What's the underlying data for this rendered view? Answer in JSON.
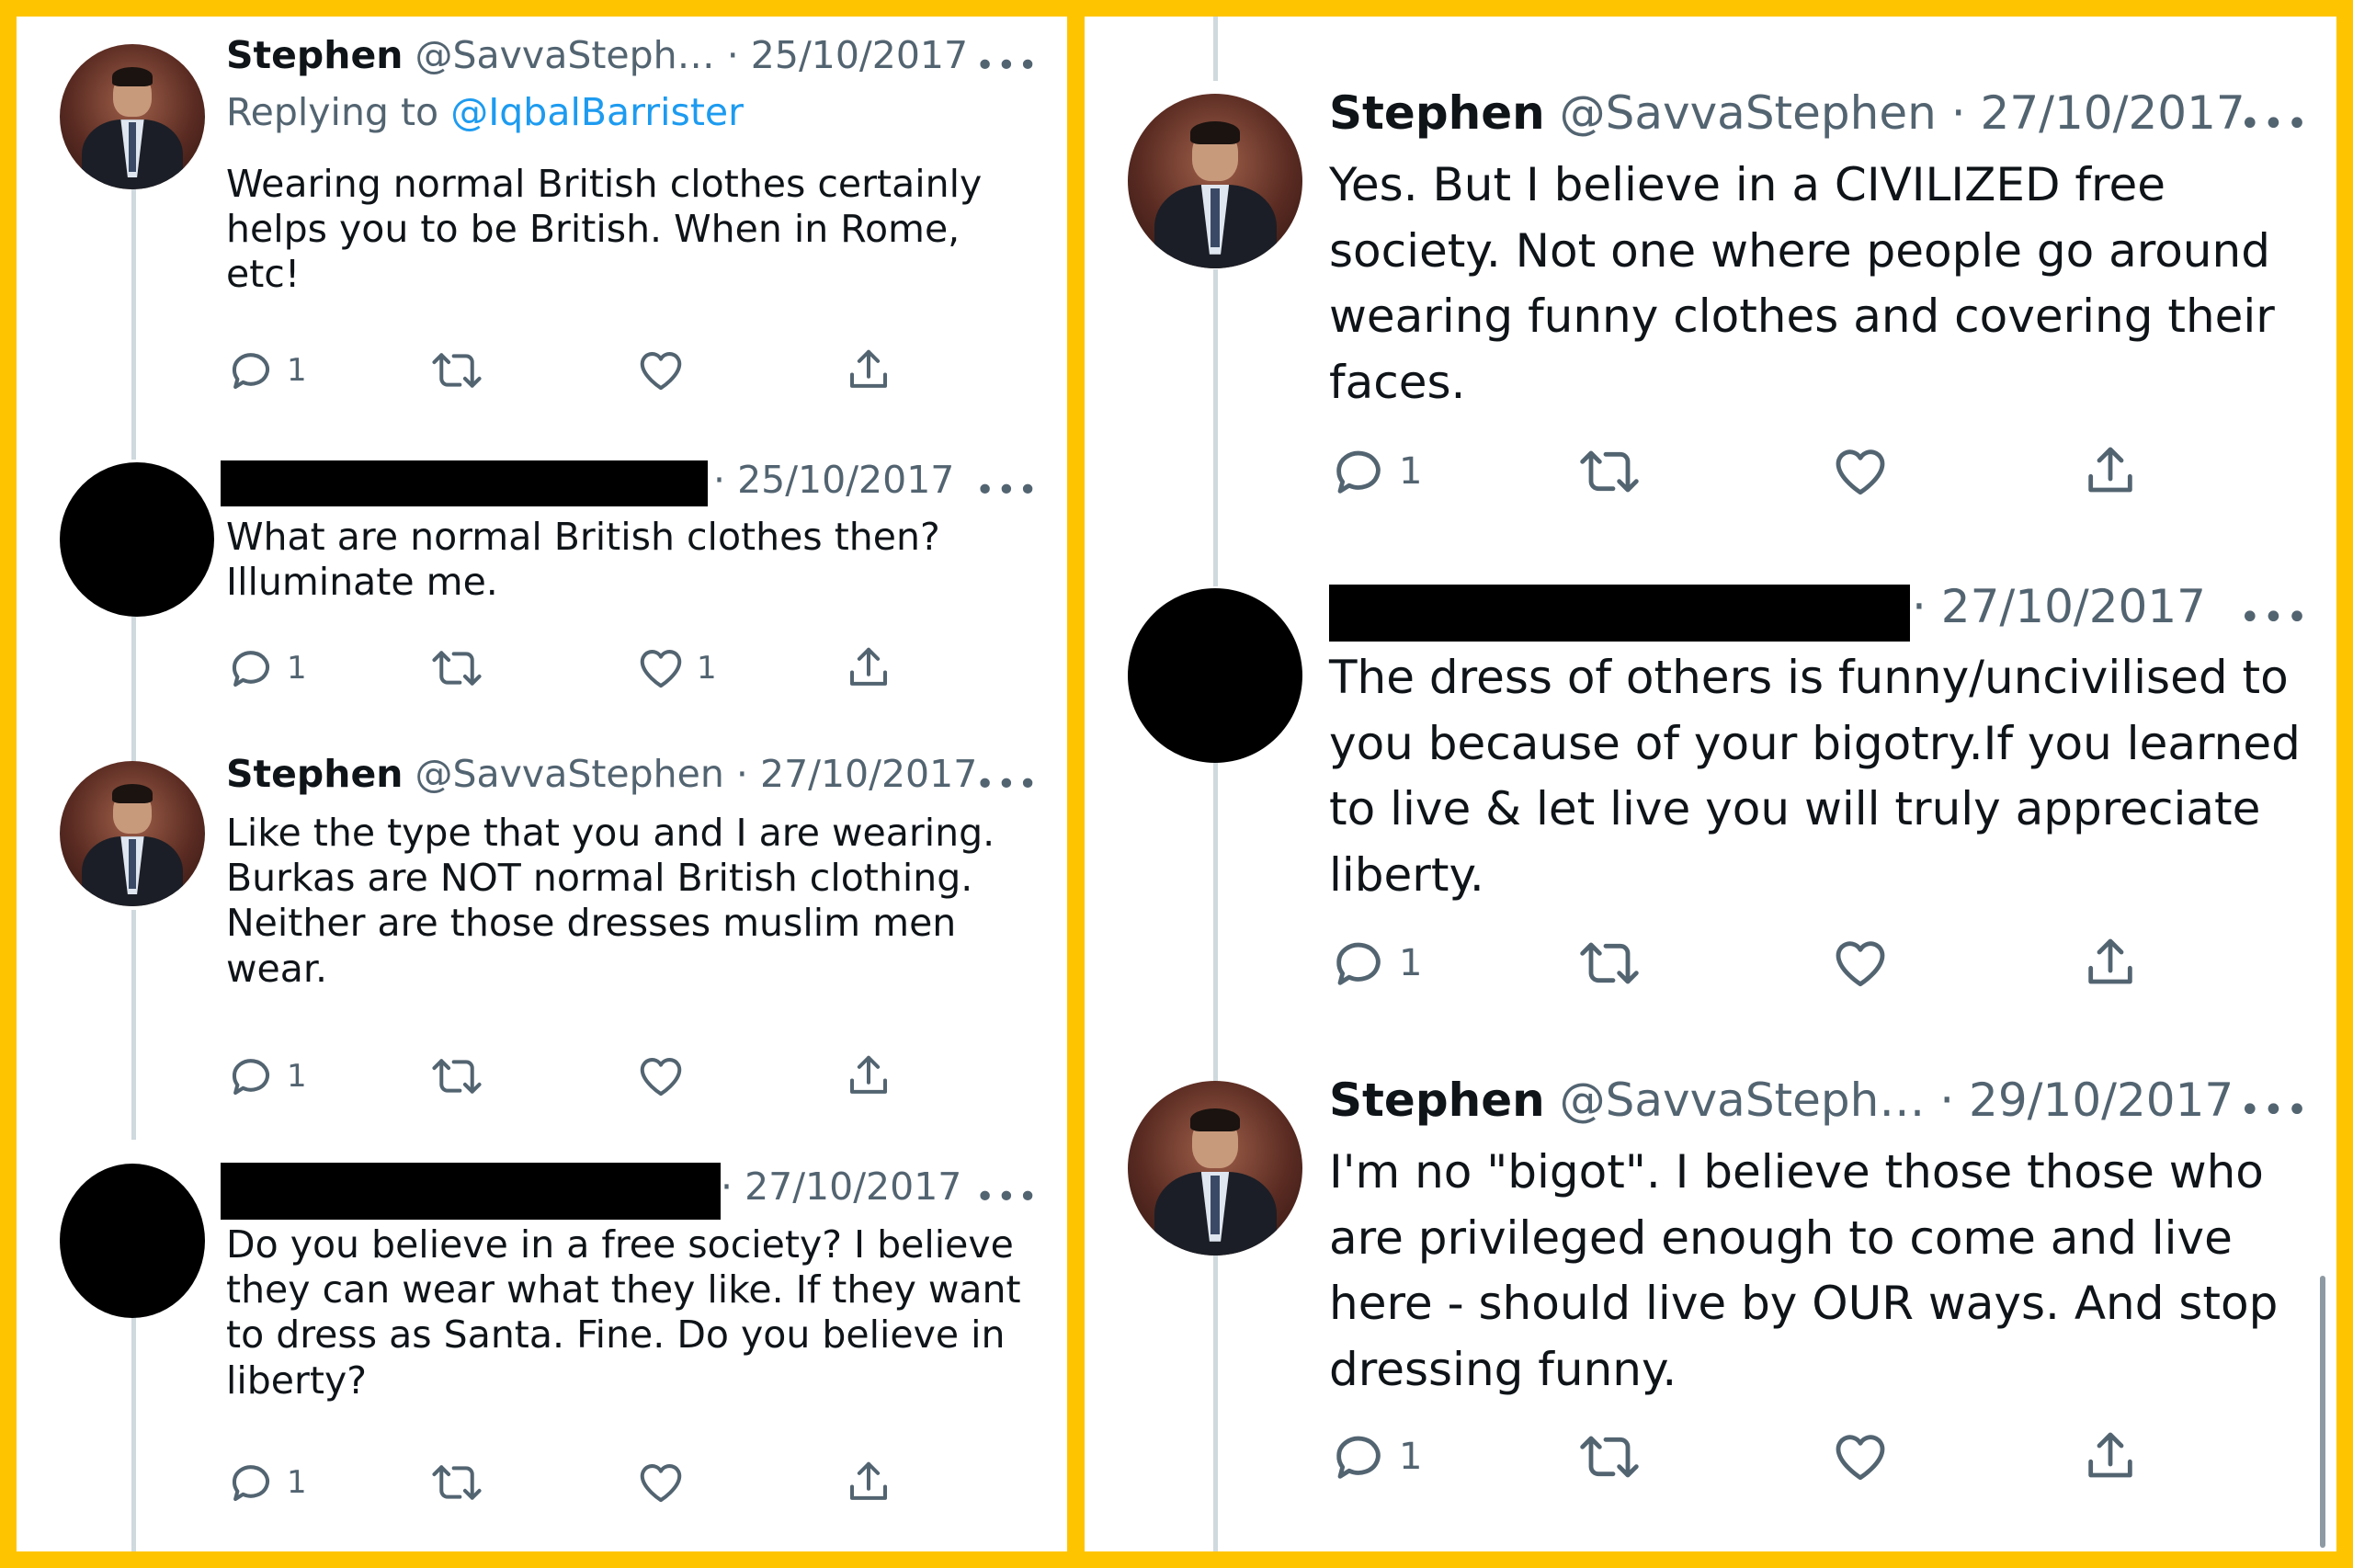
{
  "colors": {
    "frame": "#FFC400",
    "text": "#0f1419",
    "muted": "#536471",
    "link": "#1d9bf0",
    "thread_line": "#cfd9de"
  },
  "icons": {
    "reply": "speech-bubble-icon",
    "retweet": "retweet-icon",
    "like": "heart-icon",
    "share": "share-icon",
    "more": "more-dots-icon"
  },
  "left": {
    "tweets": [
      {
        "name": "Stephen",
        "handle": "@SavvaSteph…",
        "date": "· 25/10/2017",
        "reply_prefix": "Replying to ",
        "reply_to": "@IqbalBarrister",
        "text": "Wearing normal British clothes certainly\nhelps you to be British. When in Rome,\netc!",
        "reply_count": "1",
        "like_count": ""
      },
      {
        "name": "",
        "handle": "",
        "date": "· 25/10/2017",
        "text": "What are normal British clothes then?\nIlluminate me.",
        "reply_count": "1",
        "like_count": "1"
      },
      {
        "name": "Stephen",
        "handle": "@SavvaStephen",
        "date": "· 27/10/2017",
        "text": "Like the type that you and I are wearing.\nBurkas are NOT normal British clothing.\nNeither are those dresses muslim men\nwear.",
        "reply_count": "1",
        "like_count": ""
      },
      {
        "name": "",
        "handle": "",
        "date": "· 27/10/2017",
        "text": "Do you believe in a free society? I believe\nthey can wear what they like. If they want\nto dress as Santa. Fine. Do you believe in\nliberty?",
        "reply_count": "1",
        "like_count": ""
      }
    ]
  },
  "right": {
    "tweets": [
      {
        "name": "Stephen",
        "handle": "@SavvaStephen",
        "date": "· 27/10/2017",
        "text": "Yes. But I believe in a CIVILIZED free\nsociety. Not one where people go around\nwearing funny clothes and covering their\nfaces.",
        "reply_count": "1",
        "like_count": ""
      },
      {
        "name": "",
        "handle": "",
        "date": "· 27/10/2017",
        "text": "The dress of others is funny/uncivilised to\nyou because of your bigotry.If you learned\nto live & let live you will truly appreciate\nliberty.",
        "reply_count": "1",
        "like_count": ""
      },
      {
        "name": "Stephen",
        "handle": "@SavvaSteph…",
        "date": "· 29/10/2017",
        "text": "I'm no \"bigot\". I believe those those who\nare privileged enough to come and live\nhere - should live by OUR ways. And stop\ndressing funny.",
        "reply_count": "1",
        "like_count": ""
      }
    ]
  }
}
